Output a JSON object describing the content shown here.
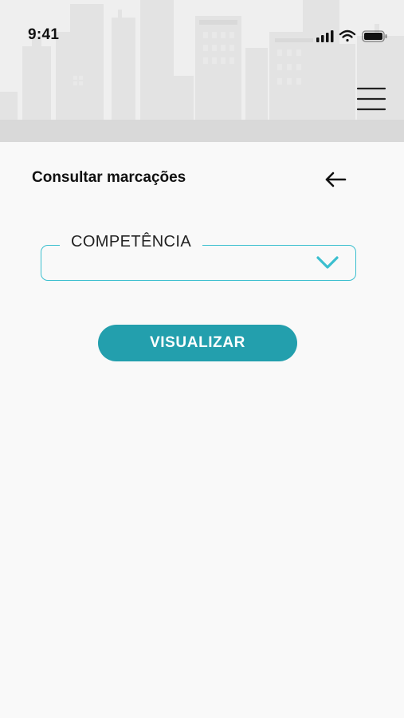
{
  "status_bar": {
    "time": "9:41",
    "icons": [
      "signal-icon",
      "wifi-icon",
      "battery-icon"
    ]
  },
  "header": {
    "menu_icon": "hamburger-menu-icon"
  },
  "page": {
    "title": "Consultar marcações",
    "back_icon": "arrow-left-icon"
  },
  "form": {
    "competencia": {
      "label": "COMPETÊNCIA",
      "value": "",
      "icon": "chevron-down-icon"
    },
    "submit_label": "VISUALIZAR"
  },
  "colors": {
    "accent": "#3bbfcf",
    "button": "#239fad",
    "background": "#f9f9f9",
    "header_bg": "#efefef"
  }
}
